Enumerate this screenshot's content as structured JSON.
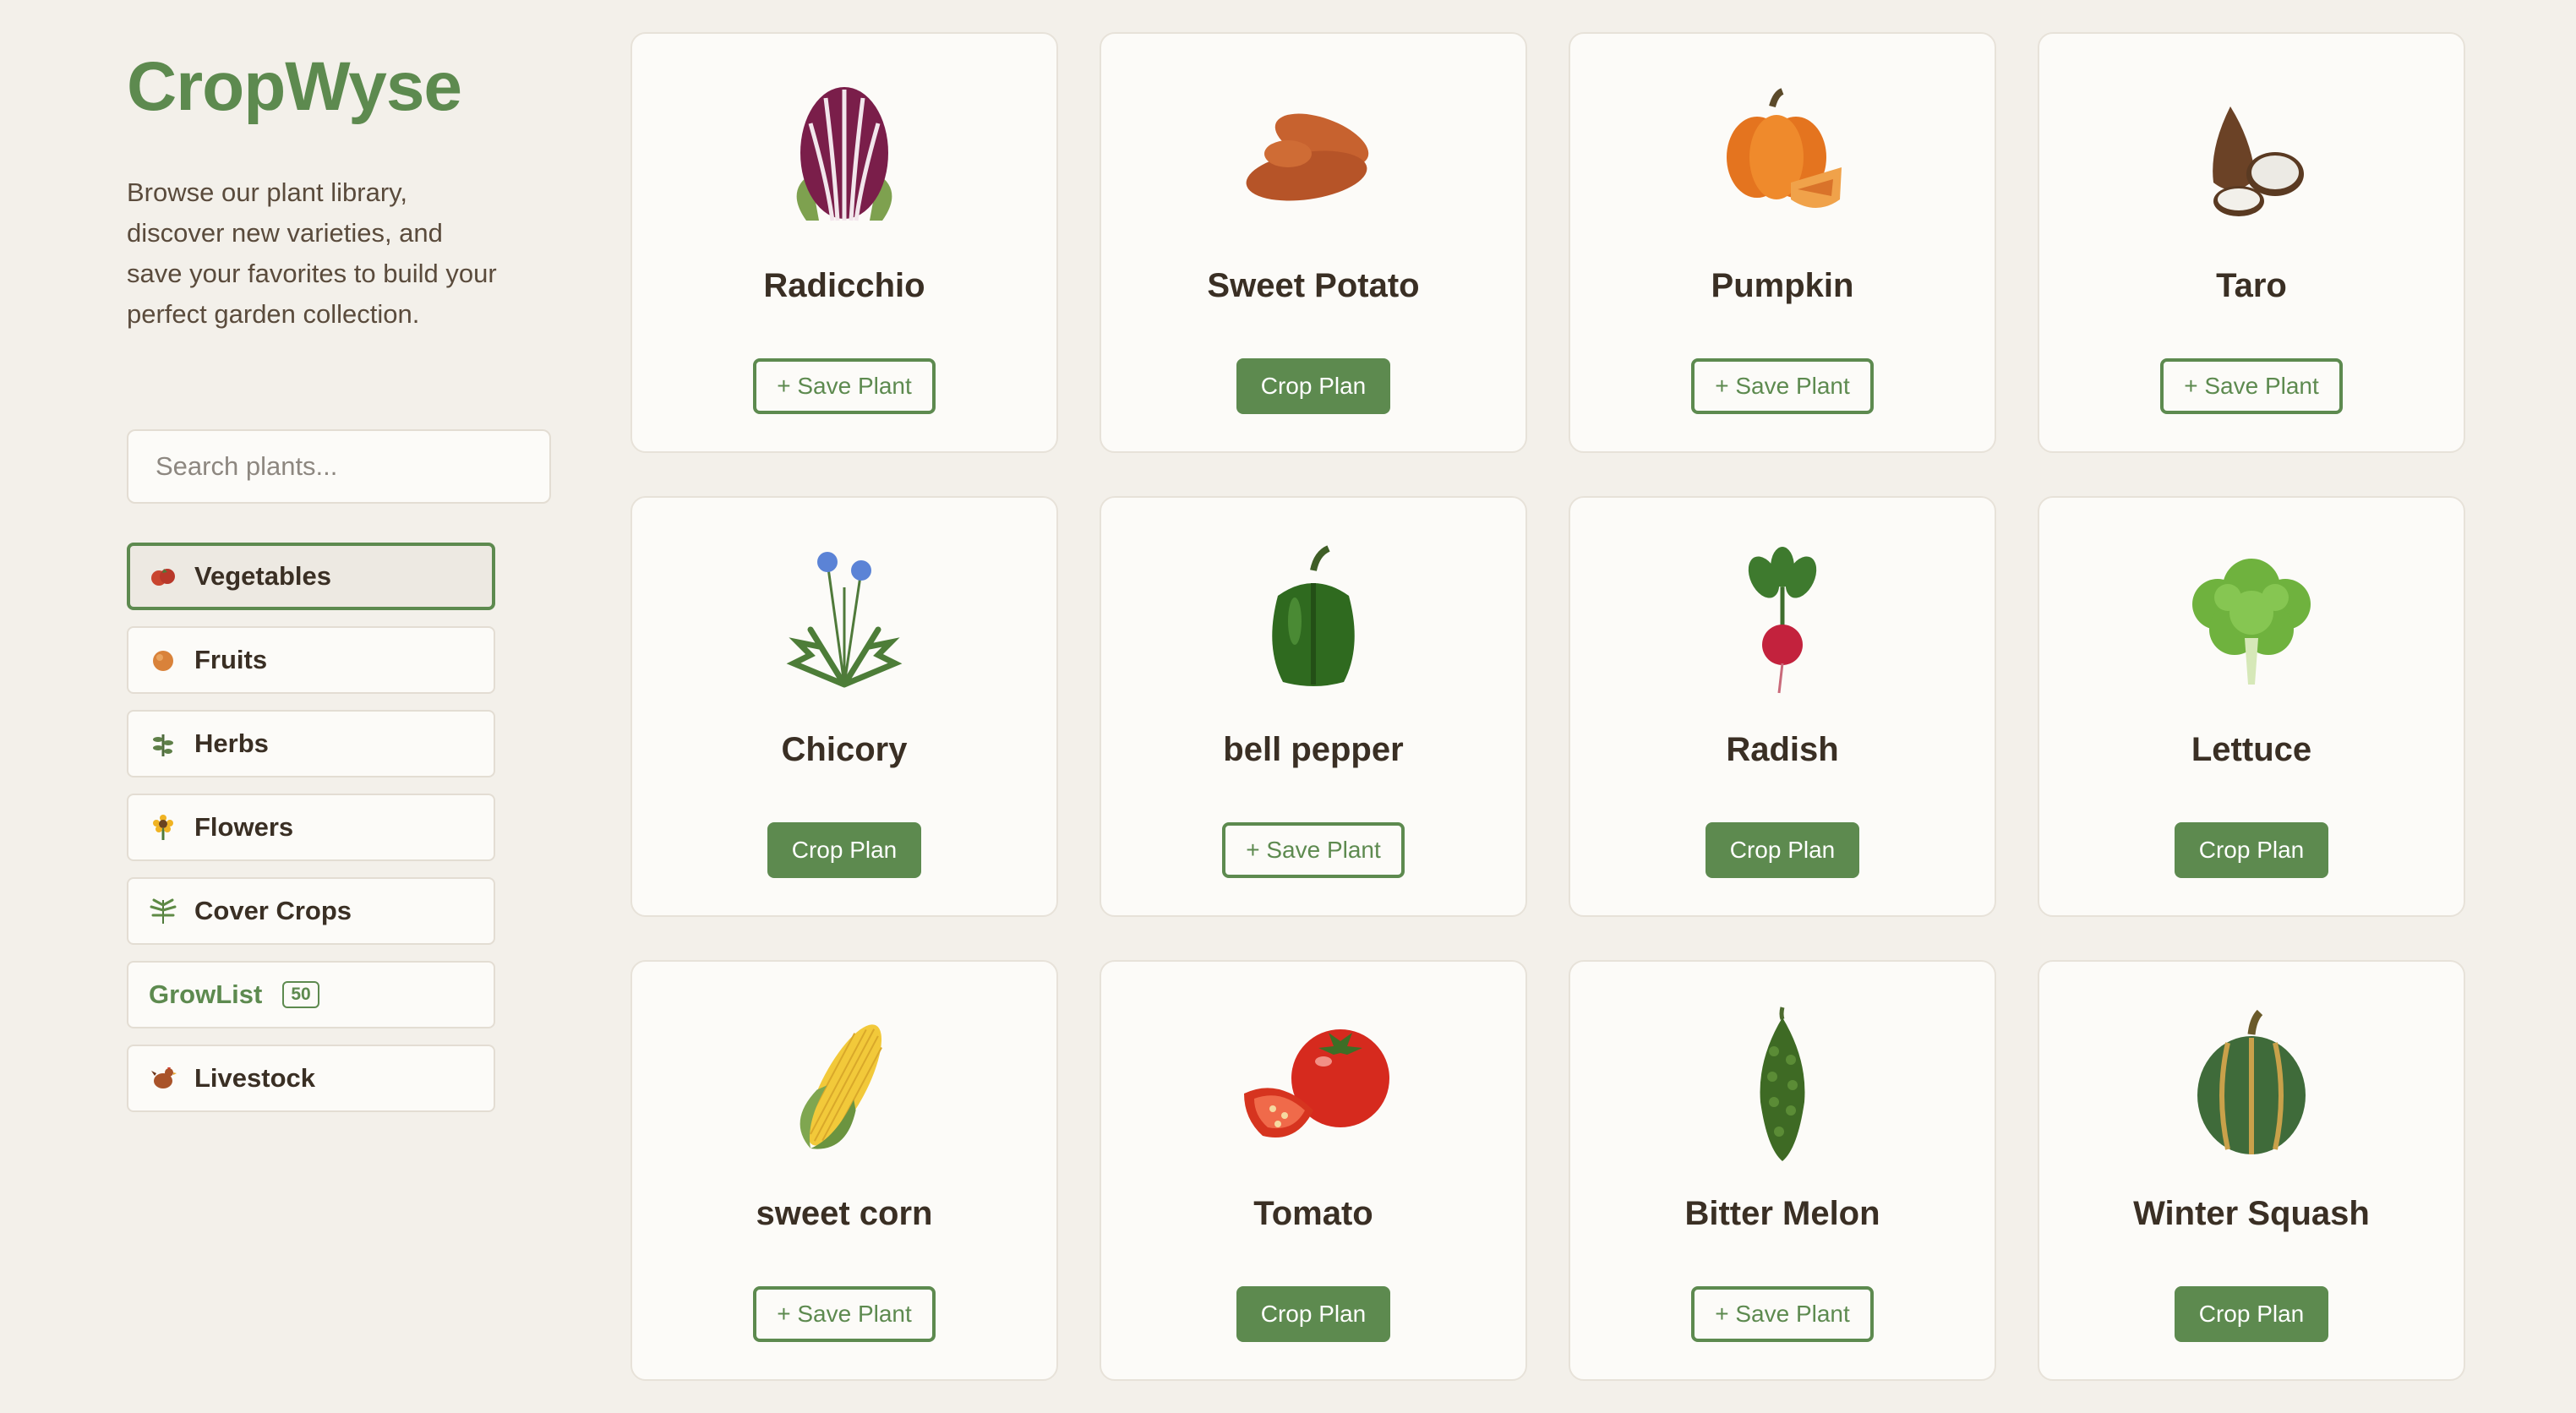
{
  "brand": "CropWyse",
  "intro": "Browse our plant library, discover new varieties, and save your favorites to build your perfect garden collection.",
  "search": {
    "placeholder": "Search plants..."
  },
  "categories": [
    {
      "label": "Vegetables",
      "icon": "tomato-icon",
      "active": true
    },
    {
      "label": "Fruits",
      "icon": "orange-icon",
      "active": false
    },
    {
      "label": "Herbs",
      "icon": "herb-icon",
      "active": false
    },
    {
      "label": "Flowers",
      "icon": "sunflower-icon",
      "active": false
    },
    {
      "label": "Cover Crops",
      "icon": "leaf-icon",
      "active": false
    },
    {
      "label": "GrowList",
      "badge": "50",
      "active": false
    },
    {
      "label": "Livestock",
      "icon": "chicken-icon",
      "active": false
    }
  ],
  "buttons": {
    "save": "+ Save Plant",
    "plan": "Crop Plan"
  },
  "plants": [
    {
      "name": "Radicchio",
      "image": "radicchio-image",
      "action": "save"
    },
    {
      "name": "Sweet Potato",
      "image": "sweet-potato-image",
      "action": "plan"
    },
    {
      "name": "Pumpkin",
      "image": "pumpkin-image",
      "action": "save"
    },
    {
      "name": "Taro",
      "image": "taro-image",
      "action": "save"
    },
    {
      "name": "Chicory",
      "image": "chicory-image",
      "action": "plan"
    },
    {
      "name": "bell pepper",
      "image": "bell-pepper-image",
      "action": "save"
    },
    {
      "name": "Radish",
      "image": "radish-image",
      "action": "plan"
    },
    {
      "name": "Lettuce",
      "image": "lettuce-image",
      "action": "plan"
    },
    {
      "name": "sweet corn",
      "image": "sweet-corn-image",
      "action": "save"
    },
    {
      "name": "Tomato",
      "image": "tomato-image",
      "action": "plan"
    },
    {
      "name": "Bitter Melon",
      "image": "bitter-melon-image",
      "action": "save"
    },
    {
      "name": "Winter Squash",
      "image": "winter-squash-image",
      "action": "plan"
    }
  ],
  "colors": {
    "accent": "#5d8a4f",
    "background": "#f3f0ea",
    "card": "#fcfbf8",
    "text": "#3a2f24"
  }
}
